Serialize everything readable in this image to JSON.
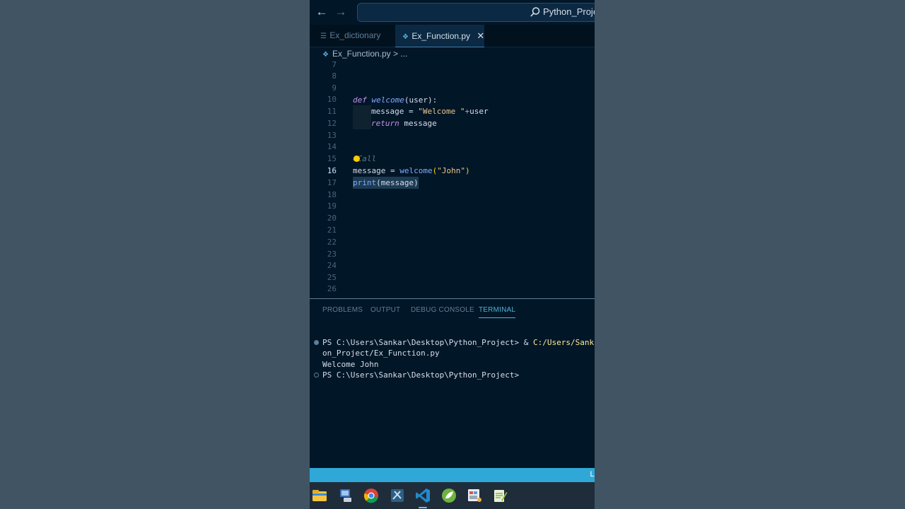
{
  "titlebar": {
    "search_text": "Python_Proje"
  },
  "tabs": [
    {
      "label": "Ex_dictionary",
      "active": false
    },
    {
      "label": "Ex_Function.py",
      "active": true
    }
  ],
  "breadcrumb": {
    "file": "Ex_Function.py",
    "separator": ">",
    "more": "..."
  },
  "editor": {
    "lines": [
      {
        "n": "7"
      },
      {
        "n": "8"
      },
      {
        "n": "9"
      },
      {
        "n": "10"
      },
      {
        "n": "11"
      },
      {
        "n": "12"
      },
      {
        "n": "13"
      },
      {
        "n": "14"
      },
      {
        "n": "15"
      },
      {
        "n": "16"
      },
      {
        "n": "17"
      },
      {
        "n": "18"
      },
      {
        "n": "19"
      },
      {
        "n": "20"
      },
      {
        "n": "21"
      },
      {
        "n": "22"
      },
      {
        "n": "23"
      },
      {
        "n": "24"
      },
      {
        "n": "25"
      },
      {
        "n": "26"
      }
    ],
    "code": {
      "l9_kw": "def",
      "l9_fn": "welcome",
      "l9_rest": "(user):",
      "l10_lhs": "message = ",
      "l10_str": "\"Welcome \"",
      "l10_op": "+",
      "l10_rest": "user",
      "l11_kw": "return",
      "l11_rest": " message",
      "l14_comment": "#Call",
      "l15_lhs": "message = ",
      "l15_fn": "welcome",
      "l15_open": "(",
      "l15_str": "\"John\"",
      "l15_close": ")",
      "l16_fn": "print",
      "l16_rest": "(message)"
    }
  },
  "panel": {
    "tabs": [
      "PROBLEMS",
      "OUTPUT",
      "DEBUG CONSOLE",
      "TERMINAL"
    ],
    "active_tab": "TERMINAL",
    "terminal": {
      "line1_prompt": "PS C:\\Users\\Sankar\\Desktop\\Python_Project> & ",
      "line1_path": "C:/Users/Sank",
      "line2": "on_Project/Ex_Function.py",
      "line3": "Welcome John",
      "line4": "PS C:\\Users\\Sankar\\Desktop\\Python_Project>"
    }
  },
  "statusbar": {
    "text": "Li"
  },
  "taskbar": {
    "apps": [
      "file-explorer",
      "network",
      "chrome",
      "snipping-tool",
      "vscode",
      "spring-tool",
      "paint",
      "notepad-plus-plus"
    ]
  },
  "colors": {
    "status_bar": "#2fa8d8",
    "editor_bg": "#011627",
    "keyword": "#c792ea",
    "function": "#82aaff",
    "string": "#ecc48d"
  }
}
